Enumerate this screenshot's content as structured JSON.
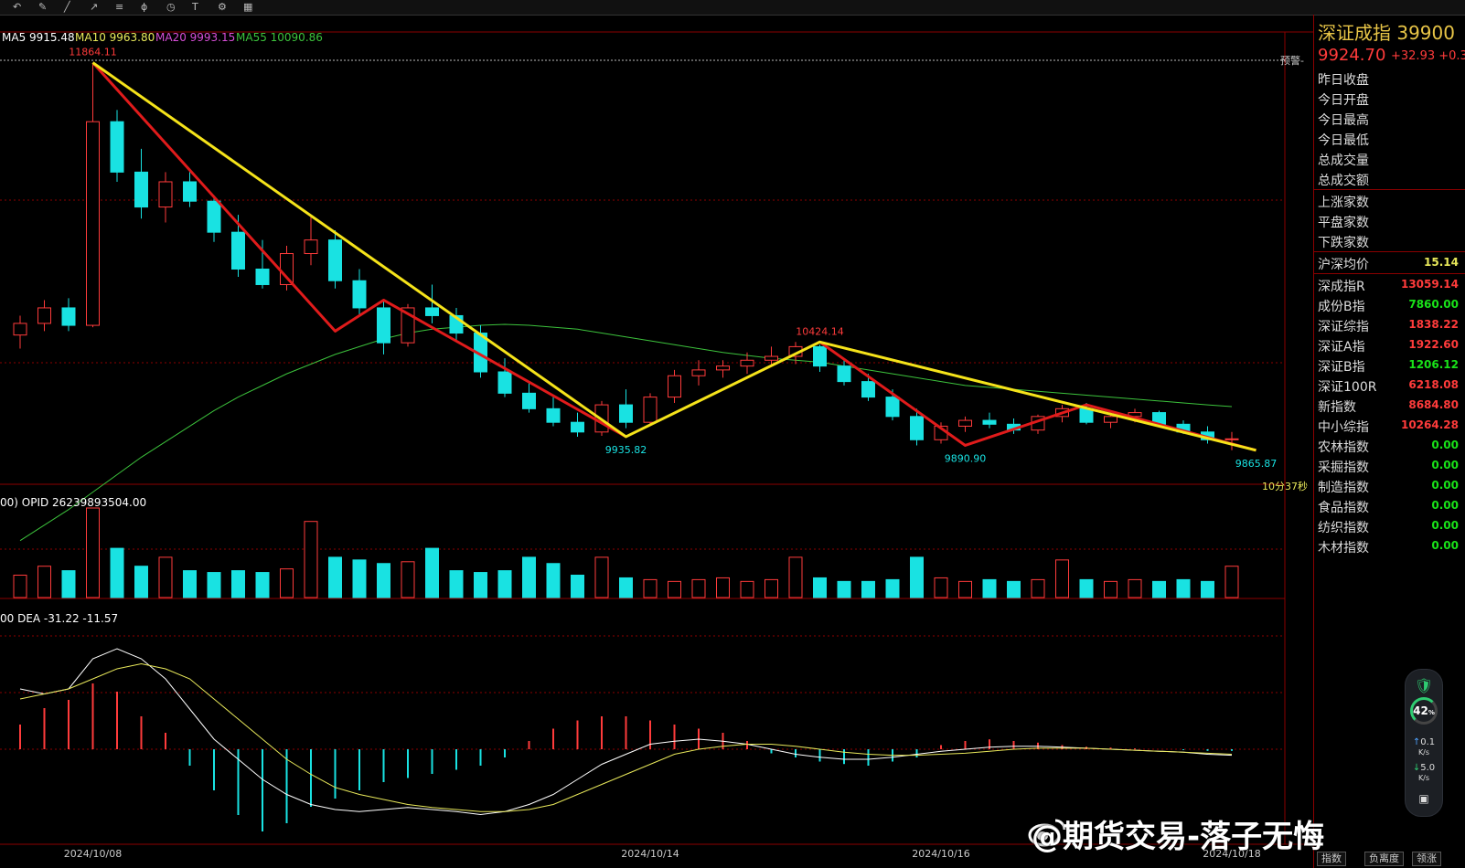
{
  "colors": {
    "up": "#ff3b3b",
    "down": "#19e2e2",
    "ma5": "#ffffff",
    "ma10": "#e8e85a",
    "ma20": "#d64ed6",
    "ma55": "#3cc23c",
    "trend_yellow": "#f5e31a",
    "trend_red": "#e01b1b",
    "grid": "#8b0000",
    "dif": "#ffffff",
    "dea": "#e8e85a"
  },
  "toolbar": {
    "icons": [
      "undo-icon",
      "draw-icon",
      "line-icon",
      "ray-icon",
      "channel-icon",
      "fib-icon",
      "period-icon",
      "text-icon",
      "settings-icon",
      "grid-icon"
    ]
  },
  "legend": {
    "ma5": "MA5 9915.48",
    "ma10": "MA10 9963.80",
    "ma20": "MA20 9993.15",
    "ma55": "MA55 10090.86"
  },
  "alert_label": "预警-",
  "volume_legend": "00)  OPID 26239893504.00",
  "macd_legend": "00   DEA -31.22      -11.57",
  "countdown": "10分37秒",
  "chart_data": {
    "type": "candlestick",
    "title": "深证成指",
    "annotations": [
      {
        "label": "11864.11",
        "x_index": 3,
        "y": 11864.11
      },
      {
        "label": "9935.82",
        "x_index": 25,
        "y": 9935.82
      },
      {
        "label": "10424.14",
        "x_index": 33,
        "y": 10424.14
      },
      {
        "label": "9890.90",
        "x_index": 39,
        "y": 9890.9
      },
      {
        "label": "9865.87",
        "x_index": 51,
        "y": 9865.87
      }
    ],
    "x_labels": [
      {
        "index": 3,
        "label": "2024/10/08"
      },
      {
        "index": 26,
        "label": "2024/10/14"
      },
      {
        "index": 38,
        "label": "2024/10/16"
      },
      {
        "index": 50,
        "label": "2024/10/18"
      }
    ],
    "ylim": [
      9700,
      11900
    ],
    "candles": [
      {
        "o": 10460,
        "h": 10560,
        "l": 10390,
        "c": 10520
      },
      {
        "o": 10520,
        "h": 10640,
        "l": 10480,
        "c": 10600
      },
      {
        "o": 10600,
        "h": 10650,
        "l": 10480,
        "c": 10510
      },
      {
        "o": 10510,
        "h": 11864.11,
        "l": 10500,
        "c": 11560
      },
      {
        "o": 11560,
        "h": 11620,
        "l": 11250,
        "c": 11300
      },
      {
        "o": 11300,
        "h": 11420,
        "l": 11060,
        "c": 11120
      },
      {
        "o": 11120,
        "h": 11300,
        "l": 11040,
        "c": 11250
      },
      {
        "o": 11250,
        "h": 11300,
        "l": 11120,
        "c": 11150
      },
      {
        "o": 11150,
        "h": 11180,
        "l": 10940,
        "c": 10990
      },
      {
        "o": 10990,
        "h": 11080,
        "l": 10760,
        "c": 10800
      },
      {
        "o": 10800,
        "h": 10950,
        "l": 10700,
        "c": 10720
      },
      {
        "o": 10720,
        "h": 10920,
        "l": 10690,
        "c": 10880
      },
      {
        "o": 10880,
        "h": 11080,
        "l": 10820,
        "c": 10950
      },
      {
        "o": 10950,
        "h": 11000,
        "l": 10700,
        "c": 10740
      },
      {
        "o": 10740,
        "h": 10800,
        "l": 10560,
        "c": 10600
      },
      {
        "o": 10600,
        "h": 10640,
        "l": 10360,
        "c": 10420
      },
      {
        "o": 10420,
        "h": 10620,
        "l": 10400,
        "c": 10600
      },
      {
        "o": 10600,
        "h": 10720,
        "l": 10520,
        "c": 10560
      },
      {
        "o": 10560,
        "h": 10600,
        "l": 10430,
        "c": 10470
      },
      {
        "o": 10470,
        "h": 10510,
        "l": 10240,
        "c": 10270
      },
      {
        "o": 10270,
        "h": 10340,
        "l": 10140,
        "c": 10160
      },
      {
        "o": 10160,
        "h": 10220,
        "l": 10060,
        "c": 10080
      },
      {
        "o": 10080,
        "h": 10140,
        "l": 9990,
        "c": 10010
      },
      {
        "o": 10010,
        "h": 10060,
        "l": 9935.82,
        "c": 9960
      },
      {
        "o": 9960,
        "h": 10120,
        "l": 9940,
        "c": 10100
      },
      {
        "o": 10100,
        "h": 10180,
        "l": 9980,
        "c": 10010
      },
      {
        "o": 10010,
        "h": 10160,
        "l": 9990,
        "c": 10140
      },
      {
        "o": 10140,
        "h": 10280,
        "l": 10110,
        "c": 10250
      },
      {
        "o": 10250,
        "h": 10330,
        "l": 10200,
        "c": 10280
      },
      {
        "o": 10280,
        "h": 10330,
        "l": 10240,
        "c": 10300
      },
      {
        "o": 10300,
        "h": 10370,
        "l": 10260,
        "c": 10330
      },
      {
        "o": 10330,
        "h": 10400,
        "l": 10300,
        "c": 10350
      },
      {
        "o": 10350,
        "h": 10424.14,
        "l": 10310,
        "c": 10400
      },
      {
        "o": 10400,
        "h": 10410,
        "l": 10270,
        "c": 10300
      },
      {
        "o": 10300,
        "h": 10330,
        "l": 10200,
        "c": 10220
      },
      {
        "o": 10220,
        "h": 10260,
        "l": 10120,
        "c": 10140
      },
      {
        "o": 10140,
        "h": 10180,
        "l": 10020,
        "c": 10040
      },
      {
        "o": 10040,
        "h": 10080,
        "l": 9890.9,
        "c": 9920
      },
      {
        "o": 9920,
        "h": 10010,
        "l": 9900,
        "c": 9990
      },
      {
        "o": 9990,
        "h": 10040,
        "l": 9960,
        "c": 10020
      },
      {
        "o": 10020,
        "h": 10060,
        "l": 9980,
        "c": 10000
      },
      {
        "o": 10000,
        "h": 10030,
        "l": 9950,
        "c": 9970
      },
      {
        "o": 9970,
        "h": 10050,
        "l": 9950,
        "c": 10040
      },
      {
        "o": 10040,
        "h": 10100,
        "l": 10010,
        "c": 10080
      },
      {
        "o": 10080,
        "h": 10110,
        "l": 10000,
        "c": 10010
      },
      {
        "o": 10010,
        "h": 10060,
        "l": 9980,
        "c": 10040
      },
      {
        "o": 10040,
        "h": 10080,
        "l": 10010,
        "c": 10060
      },
      {
        "o": 10060,
        "h": 10070,
        "l": 9990,
        "c": 10000
      },
      {
        "o": 10000,
        "h": 10020,
        "l": 9950,
        "c": 9960
      },
      {
        "o": 9960,
        "h": 9990,
        "l": 9900,
        "c": 9920
      },
      {
        "o": 9920,
        "h": 9960,
        "l": 9865.87,
        "c": 9924.7
      }
    ],
    "ma55": [
      9400,
      9480,
      9560,
      9650,
      9740,
      9830,
      9910,
      9990,
      10070,
      10140,
      10200,
      10260,
      10310,
      10360,
      10400,
      10440,
      10470,
      10490,
      10500,
      10510,
      10515,
      10510,
      10500,
      10490,
      10470,
      10450,
      10430,
      10410,
      10390,
      10370,
      10355,
      10340,
      10330,
      10320,
      10300,
      10280,
      10260,
      10240,
      10220,
      10200,
      10190,
      10180,
      10170,
      10160,
      10150,
      10140,
      10130,
      10120,
      10110,
      10100,
      10090.86
    ],
    "volume": [
      0.25,
      0.35,
      0.3,
      1.0,
      0.55,
      0.35,
      0.45,
      0.3,
      0.28,
      0.3,
      0.28,
      0.32,
      0.85,
      0.45,
      0.42,
      0.38,
      0.4,
      0.55,
      0.3,
      0.28,
      0.3,
      0.45,
      0.38,
      0.25,
      0.45,
      0.22,
      0.2,
      0.18,
      0.2,
      0.22,
      0.18,
      0.2,
      0.45,
      0.22,
      0.18,
      0.18,
      0.2,
      0.45,
      0.22,
      0.18,
      0.2,
      0.18,
      0.2,
      0.42,
      0.2,
      0.18,
      0.2,
      0.18,
      0.2,
      0.18,
      0.35
    ],
    "macd_hist": [
      0.3,
      0.5,
      0.6,
      0.8,
      0.7,
      0.4,
      0.2,
      -0.2,
      -0.5,
      -0.8,
      -1.0,
      -0.9,
      -0.7,
      -0.6,
      -0.5,
      -0.4,
      -0.35,
      -0.3,
      -0.25,
      -0.2,
      -0.1,
      0.1,
      0.25,
      0.35,
      0.4,
      0.4,
      0.35,
      0.3,
      0.25,
      0.2,
      0.1,
      -0.05,
      -0.1,
      -0.15,
      -0.18,
      -0.2,
      -0.15,
      -0.1,
      0.05,
      0.1,
      0.12,
      0.1,
      0.08,
      0.05,
      0.03,
      0.02,
      0.01,
      0.0,
      -0.01,
      -0.02,
      -0.02
    ],
    "dif": [
      0.6,
      0.55,
      0.6,
      0.9,
      1.0,
      0.9,
      0.7,
      0.4,
      0.1,
      -0.1,
      -0.3,
      -0.45,
      -0.55,
      -0.6,
      -0.62,
      -0.6,
      -0.58,
      -0.6,
      -0.62,
      -0.65,
      -0.62,
      -0.55,
      -0.45,
      -0.3,
      -0.15,
      -0.05,
      0.05,
      0.08,
      0.1,
      0.08,
      0.05,
      0.0,
      -0.05,
      -0.08,
      -0.1,
      -0.1,
      -0.08,
      -0.05,
      -0.02,
      0.0,
      0.02,
      0.03,
      0.03,
      0.02,
      0.01,
      0.0,
      -0.01,
      -0.02,
      -0.03,
      -0.05,
      -0.06
    ],
    "dea": [
      0.5,
      0.55,
      0.6,
      0.7,
      0.8,
      0.85,
      0.8,
      0.7,
      0.5,
      0.3,
      0.1,
      -0.1,
      -0.25,
      -0.38,
      -0.45,
      -0.5,
      -0.55,
      -0.58,
      -0.6,
      -0.62,
      -0.62,
      -0.6,
      -0.55,
      -0.45,
      -0.35,
      -0.25,
      -0.15,
      -0.05,
      0.0,
      0.03,
      0.05,
      0.05,
      0.03,
      0.0,
      -0.03,
      -0.05,
      -0.06,
      -0.06,
      -0.05,
      -0.04,
      -0.02,
      0.0,
      0.01,
      0.01,
      0.01,
      0.0,
      -0.01,
      -0.02,
      -0.03,
      -0.04,
      -0.05
    ],
    "trend_yellow": [
      [
        3,
        11864.11
      ],
      [
        25,
        9935.82
      ],
      [
        33,
        10424.14
      ],
      [
        51,
        9865.87
      ]
    ],
    "trend_red": [
      [
        3,
        11864.11
      ],
      [
        13,
        10480
      ],
      [
        15,
        10640
      ],
      [
        25,
        9935.82
      ]
    ],
    "trend_red2": [
      [
        33,
        10424.14
      ],
      [
        39,
        9890.9
      ],
      [
        44,
        10100
      ],
      [
        51,
        9865.87
      ]
    ]
  },
  "sidepanel": {
    "title": "深证成指  39900",
    "price": "9924.70",
    "change": "+32.93  +0.3",
    "rows_group1": [
      "昨日收盘",
      "今日开盘",
      "今日最高",
      "今日最低",
      "总成交量",
      "总成交额"
    ],
    "rows_group2": [
      "上涨家数",
      "平盘家数",
      "下跌家数"
    ],
    "avg": {
      "label": "沪深均价",
      "value": "15.14"
    },
    "indices": [
      {
        "label": "深成指R",
        "value": "13059.14",
        "color": "#ff3b3b"
      },
      {
        "label": "成份B指",
        "value": "7860.00",
        "color": "#19e219"
      },
      {
        "label": "深证综指",
        "value": "1838.22",
        "color": "#ff3b3b"
      },
      {
        "label": "深证A指",
        "value": "1922.60",
        "color": "#ff3b3b"
      },
      {
        "label": "深证B指",
        "value": "1206.12",
        "color": "#19e219"
      },
      {
        "label": "深证100R",
        "value": "6218.08",
        "color": "#ff3b3b"
      },
      {
        "label": "新指数",
        "value": "8684.80",
        "color": "#ff3b3b"
      },
      {
        "label": "中小综指",
        "value": "10264.28",
        "color": "#ff3b3b"
      },
      {
        "label": "农林指数",
        "value": "0.00",
        "color": "#19e219"
      },
      {
        "label": "采掘指数",
        "value": "0.00",
        "color": "#19e219"
      },
      {
        "label": "制造指数",
        "value": "0.00",
        "color": "#19e219"
      },
      {
        "label": "食品指数",
        "value": "0.00",
        "color": "#19e219"
      },
      {
        "label": "纺织指数",
        "value": "0.00",
        "color": "#19e219"
      },
      {
        "label": "木材指数",
        "value": "0.00",
        "color": "#19e219"
      }
    ]
  },
  "gauge": {
    "percent": "42",
    "unit": "%",
    "up_speed": "0.1",
    "down_speed": "5.0",
    "speed_unit": "K/s"
  },
  "bottom_tabs": [
    "指数",
    "负离度",
    "领涨"
  ],
  "watermark": "@期货交易-落子无悔"
}
